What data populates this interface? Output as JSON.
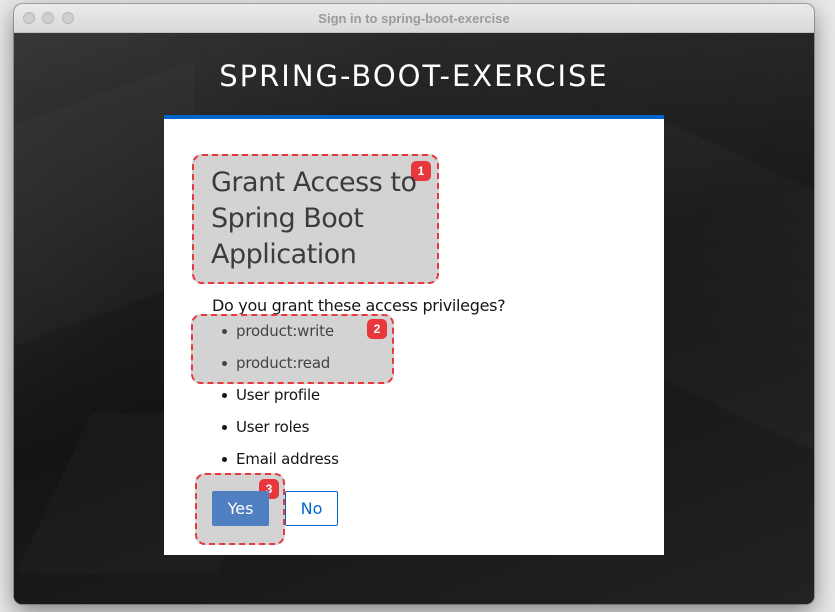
{
  "window": {
    "title": "Sign in to spring-boot-exercise"
  },
  "realm": {
    "title": "SPRING-BOOT-EXERCISE"
  },
  "consent": {
    "heading": "Grant Access to Spring Boot Application",
    "question": "Do you grant these access privileges?",
    "scopes": [
      "product:write",
      "product:read",
      "User profile",
      "User roles",
      "Email address"
    ],
    "yes_label": "Yes",
    "no_label": "No"
  },
  "annotations": {
    "badges": [
      "1",
      "2",
      "3"
    ],
    "color": "#e8383d"
  },
  "colors": {
    "accent": "#0066cc",
    "primary_button": "#4f7fc0"
  },
  "icons": [
    "window-close-icon",
    "window-minimize-icon",
    "window-zoom-icon"
  ]
}
